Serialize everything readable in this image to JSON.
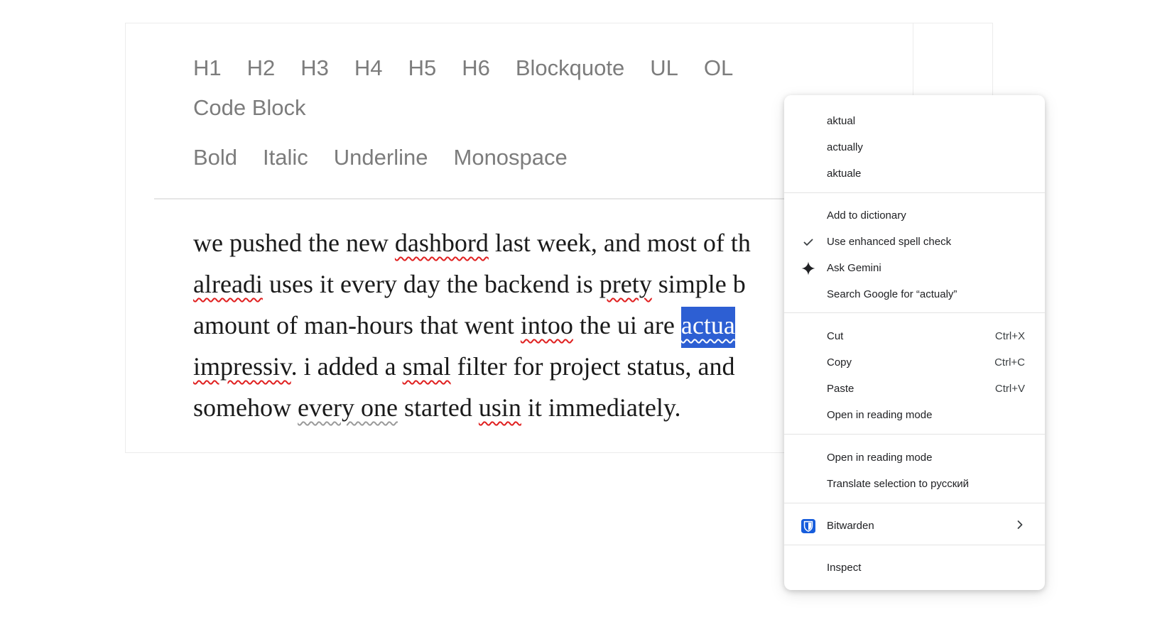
{
  "toolbar": {
    "blocks": [
      "H1",
      "H2",
      "H3",
      "H4",
      "H5",
      "H6",
      "Blockquote",
      "UL",
      "OL",
      "Code Block"
    ],
    "marks": [
      "Bold",
      "Italic",
      "Underline",
      "Monospace"
    ]
  },
  "content": {
    "l1": {
      "a": "we pushed the new ",
      "b": "dashbord",
      "c": " last week, and most of th"
    },
    "l2": {
      "a": "alreadi",
      "b": " uses it every day the backend is ",
      "c": "prety",
      "d": " simple b"
    },
    "l3": {
      "a": "amount of man-hours that went ",
      "b": "intoo",
      "c": " the ui are ",
      "d": "actua"
    },
    "l4": {
      "a": "impressiv",
      "b": ". i added a ",
      "c": "smal",
      "d": " filter for project status, and"
    },
    "l5": {
      "a": "somehow ",
      "b": "every one",
      "c": " started ",
      "d": "usin",
      "e": " it immediately."
    }
  },
  "context_menu": {
    "suggestions": [
      "aktual",
      "actually",
      "aktuale"
    ],
    "add_to_dictionary": "Add to dictionary",
    "enhanced_spell_check": "Use enhanced spell check",
    "ask_gemini": "Ask Gemini",
    "search_google": "Search Google for “actualy”",
    "cut": {
      "label": "Cut",
      "shortcut": "Ctrl+X"
    },
    "copy": {
      "label": "Copy",
      "shortcut": "Ctrl+C"
    },
    "paste": {
      "label": "Paste",
      "shortcut": "Ctrl+V"
    },
    "open_reading_mode_1": "Open in reading mode",
    "open_reading_mode_2": "Open in reading mode",
    "translate": "Translate selection to русский",
    "bitwarden": "Bitwarden",
    "inspect": "Inspect"
  },
  "colors": {
    "selection": "#2d5fd3",
    "spell_error": "#e02020",
    "grammar_hint": "#9a9a9a",
    "bitwarden_brand": "#175ddc"
  }
}
